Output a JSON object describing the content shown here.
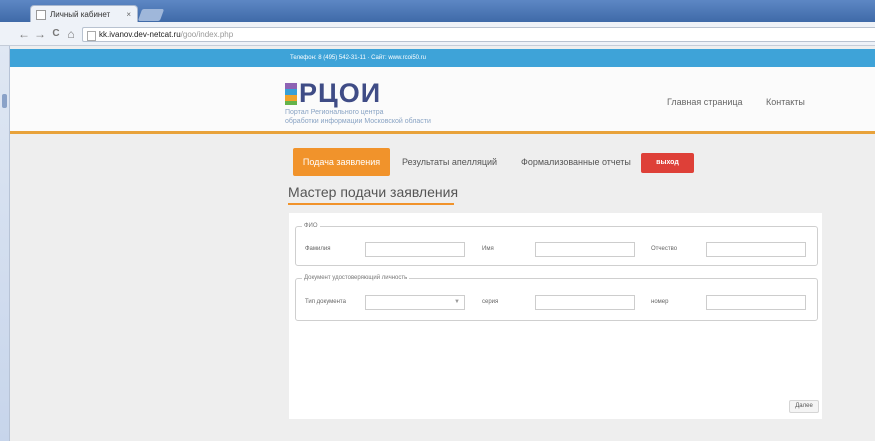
{
  "browser": {
    "tab_title": "Личный кабинет",
    "tab_close": "×",
    "back": "←",
    "forward": "→",
    "reload": "C",
    "home": "⌂",
    "url_host": "kk.ivanov.dev-netcat.ru",
    "url_path": "/goo/index.php"
  },
  "site": {
    "topbar_text": "Телефон: 8 (495) 542-31-11 · Сайт: www.rcoi50.ru",
    "logo_word": "РЦОИ",
    "logo_sub1": "Портал Регионального центра",
    "logo_sub2": "обработки информации Московской области",
    "logo_colors": [
      "#8e63b4",
      "#39a0d6",
      "#f0a32b",
      "#64b34a"
    ],
    "header_links": [
      "Главная страница",
      "Контакты"
    ]
  },
  "nav": {
    "active": "Подача заявления",
    "items": [
      "Результаты апелляций",
      "Формализованные отчеты"
    ],
    "exit": "выход"
  },
  "page": {
    "title": "Мастер подачи заявления"
  },
  "form": {
    "fio_legend": "ФИО",
    "surname_label": "Фамилия",
    "name_label": "Имя",
    "patronymic_label": "Отчество",
    "doc_legend": "Документ удостоверяющий личность",
    "doctype_label": "Тип документа",
    "doctype_value": "",
    "series_label": "серия",
    "number_label": "номер",
    "next_button": "Далее"
  },
  "colors": {
    "accent": "#f1932b",
    "topbar": "#3ea3d8",
    "exit": "#de4038",
    "logo_text": "#3f4c86"
  }
}
